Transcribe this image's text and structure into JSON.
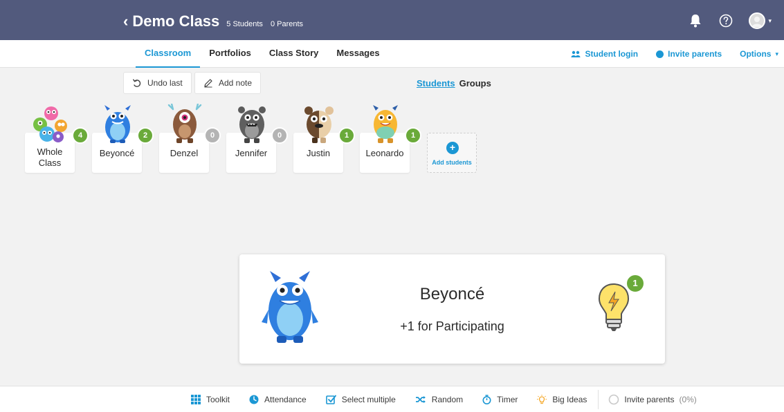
{
  "header": {
    "class_name": "Demo Class",
    "students_count": "5 Students",
    "parents_count": "0 Parents"
  },
  "nav": {
    "tabs": [
      {
        "label": "Classroom",
        "active": true
      },
      {
        "label": "Portfolios",
        "active": false
      },
      {
        "label": "Class Story",
        "active": false
      },
      {
        "label": "Messages",
        "active": false
      }
    ],
    "student_login": "Student login",
    "invite_parents": "Invite parents",
    "options": "Options"
  },
  "actions": {
    "undo_label": "Undo last",
    "note_label": "Add note"
  },
  "view_toggle": {
    "students": "Students",
    "groups": "Groups"
  },
  "students": [
    {
      "name": "Whole Class",
      "line1": "Whole",
      "line2": "Class",
      "points": "4",
      "badge_color": "#6aaa3a",
      "icon": "monster-group-icon"
    },
    {
      "name": "Beyoncé",
      "points": "2",
      "badge_color": "#6aaa3a",
      "icon": "blue-monster-icon"
    },
    {
      "name": "Denzel",
      "points": "0",
      "badge_color": "#b4b4b4",
      "icon": "brown-cyclops-monster-icon"
    },
    {
      "name": "Jennifer",
      "points": "0",
      "badge_color": "#b4b4b4",
      "icon": "grey-monster-icon"
    },
    {
      "name": "Justin",
      "points": "1",
      "badge_color": "#6aaa3a",
      "icon": "bear-monster-icon"
    },
    {
      "name": "Leonardo",
      "points": "1",
      "badge_color": "#6aaa3a",
      "icon": "yellow-monster-icon"
    }
  ],
  "add_students": "Add students",
  "popup": {
    "student": "Beyoncé",
    "reason": "+1 for Participating",
    "points": "1",
    "icon": "lightbulb-icon"
  },
  "toolbar": {
    "toolkit": "Toolkit",
    "attendance": "Attendance",
    "select_multiple": "Select multiple",
    "random": "Random",
    "timer": "Timer",
    "big_ideas": "Big Ideas",
    "invite_parents": "Invite parents",
    "invite_pct": "(0%)"
  },
  "colors": {
    "header_bg": "#525a7d",
    "accent": "#1b97d4",
    "positive": "#6aaa3a",
    "neutral": "#b4b4b4"
  }
}
